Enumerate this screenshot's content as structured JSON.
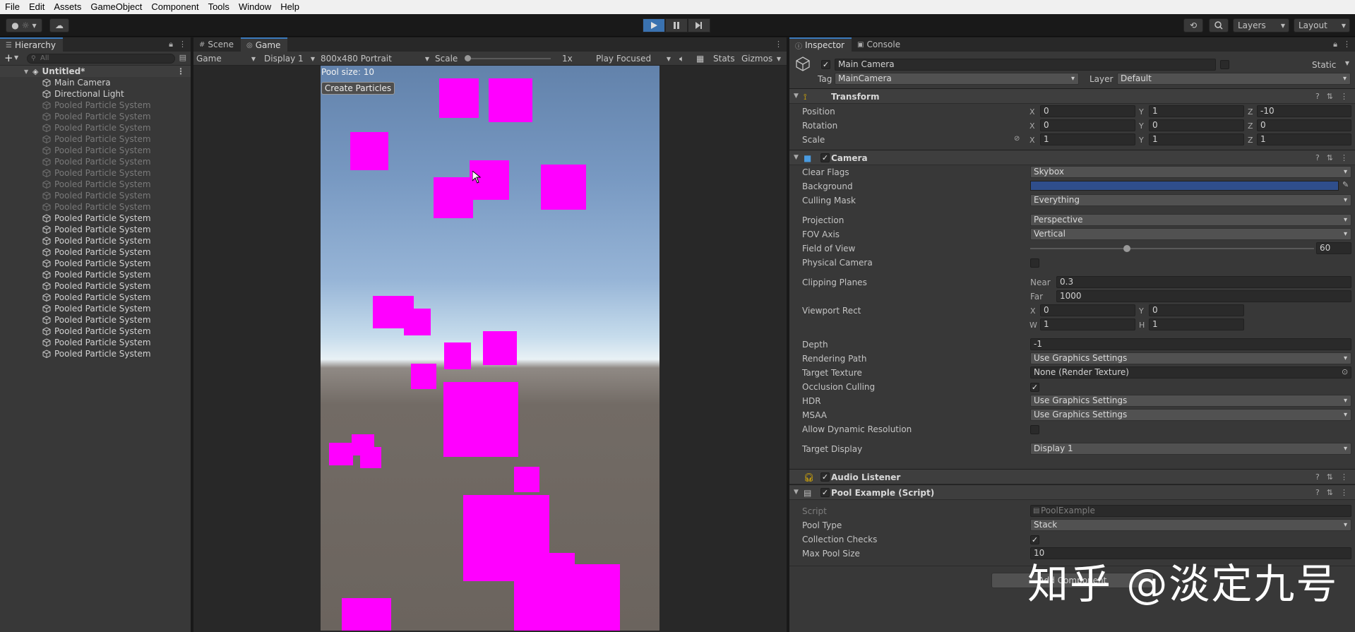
{
  "menu": [
    "File",
    "Edit",
    "Assets",
    "GameObject",
    "Component",
    "Tools",
    "Window",
    "Help"
  ],
  "toolbar": {
    "account_icon": "account-icon",
    "layers_label": "Layers",
    "layout_label": "Layout"
  },
  "hierarchy": {
    "tab_label": "Hierarchy",
    "search_placeholder": "All",
    "scene_name": "Untitled*",
    "items": [
      {
        "label": "Main Camera",
        "active": true
      },
      {
        "label": "Directional Light",
        "active": true
      },
      {
        "label": "Pooled Particle System",
        "active": false
      },
      {
        "label": "Pooled Particle System",
        "active": false
      },
      {
        "label": "Pooled Particle System",
        "active": false
      },
      {
        "label": "Pooled Particle System",
        "active": false
      },
      {
        "label": "Pooled Particle System",
        "active": false
      },
      {
        "label": "Pooled Particle System",
        "active": false
      },
      {
        "label": "Pooled Particle System",
        "active": false
      },
      {
        "label": "Pooled Particle System",
        "active": false
      },
      {
        "label": "Pooled Particle System",
        "active": false
      },
      {
        "label": "Pooled Particle System",
        "active": false
      },
      {
        "label": "Pooled Particle System",
        "active": true
      },
      {
        "label": "Pooled Particle System",
        "active": true
      },
      {
        "label": "Pooled Particle System",
        "active": true
      },
      {
        "label": "Pooled Particle System",
        "active": true
      },
      {
        "label": "Pooled Particle System",
        "active": true
      },
      {
        "label": "Pooled Particle System",
        "active": true
      },
      {
        "label": "Pooled Particle System",
        "active": true
      },
      {
        "label": "Pooled Particle System",
        "active": true
      },
      {
        "label": "Pooled Particle System",
        "active": true
      },
      {
        "label": "Pooled Particle System",
        "active": true
      },
      {
        "label": "Pooled Particle System",
        "active": true
      },
      {
        "label": "Pooled Particle System",
        "active": true
      },
      {
        "label": "Pooled Particle System",
        "active": true
      }
    ]
  },
  "gameview": {
    "tabs": [
      "Scene",
      "Game"
    ],
    "mode": "Game",
    "display": "Display 1",
    "resolution": "800x480 Portrait",
    "scale_label": "Scale",
    "scale_value": "1x",
    "play_focused": "Play Focused",
    "stats": "Stats",
    "gizmos": "Gizmos",
    "pool_size_label": "Pool size: 10",
    "create_button": "Create Particles",
    "particle_color": "#ff00ff"
  },
  "inspector": {
    "tabs": [
      "Inspector",
      "Console"
    ],
    "object_name": "Main Camera",
    "static_label": "Static",
    "tag_label": "Tag",
    "tag_value": "MainCamera",
    "layer_label": "Layer",
    "layer_value": "Default",
    "transform": {
      "title": "Transform",
      "position_label": "Position",
      "rotation_label": "Rotation",
      "scale_label": "Scale",
      "position": [
        "0",
        "1",
        "-10"
      ],
      "rotation": [
        "0",
        "0",
        "0"
      ],
      "scale": [
        "1",
        "1",
        "1"
      ]
    },
    "camera": {
      "title": "Camera",
      "clear_flags_label": "Clear Flags",
      "clear_flags": "Skybox",
      "background_label": "Background",
      "background_color": "#2f4e8c",
      "culling_mask_label": "Culling Mask",
      "culling_mask": "Everything",
      "projection_label": "Projection",
      "projection": "Perspective",
      "fov_axis_label": "FOV Axis",
      "fov_axis": "Vertical",
      "fov_label": "Field of View",
      "fov": "60",
      "physical_label": "Physical Camera",
      "clipping_label": "Clipping Planes",
      "near_label": "Near",
      "near": "0.3",
      "far_label": "Far",
      "far": "1000",
      "viewport_label": "Viewport Rect",
      "viewport": {
        "x": "0",
        "y": "0",
        "w": "1",
        "h": "1"
      },
      "depth_label": "Depth",
      "depth": "-1",
      "rendering_path_label": "Rendering Path",
      "rendering_path": "Use Graphics Settings",
      "target_texture_label": "Target Texture",
      "target_texture": "None (Render Texture)",
      "occlusion_label": "Occlusion Culling",
      "hdr_label": "HDR",
      "hdr": "Use Graphics Settings",
      "msaa_label": "MSAA",
      "msaa": "Use Graphics Settings",
      "dynres_label": "Allow Dynamic Resolution",
      "target_display_label": "Target Display",
      "target_display": "Display 1"
    },
    "audio_listener": {
      "title": "Audio Listener"
    },
    "pool_example": {
      "title": "Pool Example (Script)",
      "script_label": "Script",
      "script": "PoolExample",
      "pool_type_label": "Pool Type",
      "pool_type": "Stack",
      "collection_checks_label": "Collection Checks",
      "max_pool_size_label": "Max Pool Size",
      "max_pool_size": "10"
    },
    "add_component": "Add Component"
  },
  "watermark": "知乎 @淡定九号"
}
